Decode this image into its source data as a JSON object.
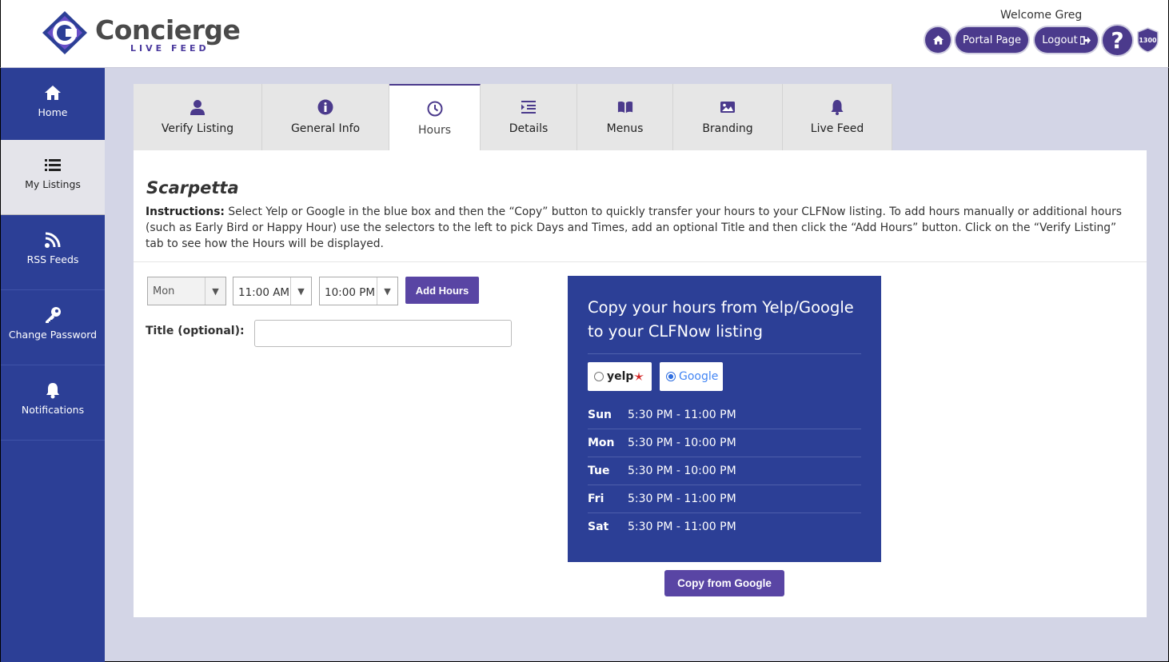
{
  "header": {
    "brand_name": "Concierge",
    "brand_sub": "LIVE FEED",
    "welcome": "Welcome Greg",
    "portal_label": "Portal Page",
    "logout_label": "Logout",
    "help_label": "?",
    "badge_text": "1300"
  },
  "sidebar": {
    "items": [
      {
        "label": "Home",
        "icon": "home-icon"
      },
      {
        "label": "My Listings",
        "icon": "list-icon",
        "active": true
      },
      {
        "label": "RSS Feeds",
        "icon": "rss-icon"
      },
      {
        "label": "Change Password",
        "icon": "key-icon"
      },
      {
        "label": "Notifications",
        "icon": "bell-icon"
      }
    ]
  },
  "tabs": [
    {
      "label": "Verify Listing",
      "icon": "user-icon"
    },
    {
      "label": "General Info",
      "icon": "info-icon"
    },
    {
      "label": "Hours",
      "icon": "clock-icon",
      "active": true
    },
    {
      "label": "Details",
      "icon": "indent-icon"
    },
    {
      "label": "Menus",
      "icon": "book-icon"
    },
    {
      "label": "Branding",
      "icon": "image-icon"
    },
    {
      "label": "Live Feed",
      "icon": "bell-icon"
    }
  ],
  "listing": {
    "name": "Scarpetta",
    "instructions_label": "Instructions:",
    "instructions_text": " Select Yelp or Google in the blue box and then the “Copy” button to quickly transfer your hours to your CLFNow listing. To add hours manually or additional hours (such as Early Bird or Happy Hour) use the selectors to the left to pick Days and Times, add an optional Title and then click the “Add Hours” button. Click on the “Verify Listing” tab to see how the Hours will be displayed."
  },
  "form": {
    "day_value": "Mon",
    "from_value": "11:00 AM",
    "to_value": "10:00 PM",
    "add_label": "Add Hours",
    "title_label": "Title (optional):",
    "title_value": ""
  },
  "copy_box": {
    "heading": "Copy your hours from Yelp/Google to your CLFNow listing",
    "yelp_label": "yelp",
    "google_label": "Google",
    "selected_source": "Google",
    "hours": [
      {
        "day": "Sun",
        "time": "5:30 PM - 11:00 PM"
      },
      {
        "day": "Mon",
        "time": "5:30 PM - 10:00 PM"
      },
      {
        "day": "Tue",
        "time": "5:30 PM - 10:00 PM"
      },
      {
        "day": "Fri",
        "time": "5:30 PM - 11:00 PM"
      },
      {
        "day": "Sat",
        "time": "5:30 PM - 11:00 PM"
      }
    ],
    "copy_label": "Copy from Google"
  },
  "colors": {
    "primary": "#2c3f96",
    "accent": "#4b3a8c",
    "button": "#5945a4",
    "page_bg": "#d3d5e6"
  }
}
